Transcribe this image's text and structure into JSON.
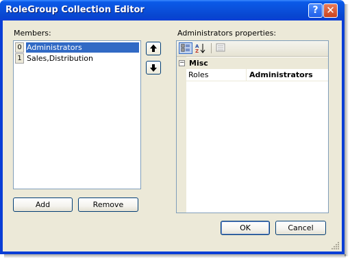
{
  "window": {
    "title": "RoleGroup Collection Editor",
    "help_glyph": "?",
    "close_glyph": "✕"
  },
  "members": {
    "label": "Members:",
    "items": [
      {
        "index": "0",
        "text": "Administrators",
        "selected": true
      },
      {
        "index": "1",
        "text": "Sales,Distribution",
        "selected": false
      }
    ],
    "move_up_icon": "arrow-up-icon",
    "move_down_icon": "arrow-down-icon"
  },
  "buttons": {
    "add": "Add",
    "remove": "Remove",
    "ok": "OK",
    "cancel": "Cancel"
  },
  "properties": {
    "label": "Administrators properties:",
    "toolbar": {
      "tools": [
        "categorized-icon",
        "alphabetical-icon",
        "property-pages-icon"
      ],
      "alphabetical_glyph": "A Z"
    },
    "category": {
      "name": "Misc",
      "expander": "−"
    },
    "rows": [
      {
        "name": "Roles",
        "value": "Administrators"
      }
    ]
  },
  "colors": {
    "titlebar": "#0a50dc",
    "selection": "#316ac5",
    "face": "#ece9d8"
  }
}
